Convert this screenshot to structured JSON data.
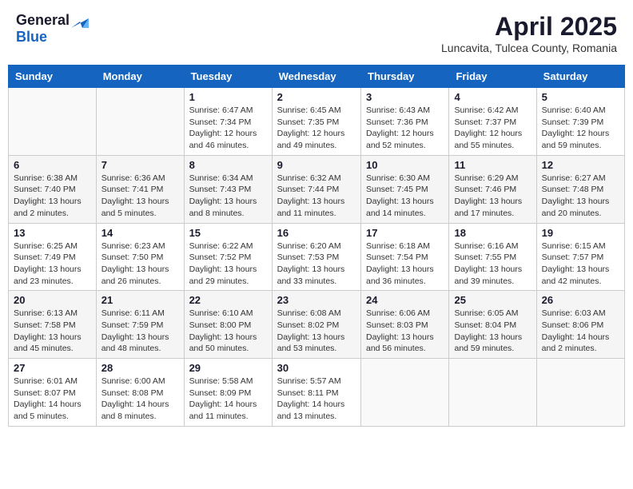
{
  "header": {
    "logo_general": "General",
    "logo_blue": "Blue",
    "month_title": "April 2025",
    "location": "Luncavita, Tulcea County, Romania"
  },
  "days_of_week": [
    "Sunday",
    "Monday",
    "Tuesday",
    "Wednesday",
    "Thursday",
    "Friday",
    "Saturday"
  ],
  "weeks": [
    [
      {
        "day": "",
        "detail": ""
      },
      {
        "day": "",
        "detail": ""
      },
      {
        "day": "1",
        "detail": "Sunrise: 6:47 AM\nSunset: 7:34 PM\nDaylight: 12 hours and 46 minutes."
      },
      {
        "day": "2",
        "detail": "Sunrise: 6:45 AM\nSunset: 7:35 PM\nDaylight: 12 hours and 49 minutes."
      },
      {
        "day": "3",
        "detail": "Sunrise: 6:43 AM\nSunset: 7:36 PM\nDaylight: 12 hours and 52 minutes."
      },
      {
        "day": "4",
        "detail": "Sunrise: 6:42 AM\nSunset: 7:37 PM\nDaylight: 12 hours and 55 minutes."
      },
      {
        "day": "5",
        "detail": "Sunrise: 6:40 AM\nSunset: 7:39 PM\nDaylight: 12 hours and 59 minutes."
      }
    ],
    [
      {
        "day": "6",
        "detail": "Sunrise: 6:38 AM\nSunset: 7:40 PM\nDaylight: 13 hours and 2 minutes."
      },
      {
        "day": "7",
        "detail": "Sunrise: 6:36 AM\nSunset: 7:41 PM\nDaylight: 13 hours and 5 minutes."
      },
      {
        "day": "8",
        "detail": "Sunrise: 6:34 AM\nSunset: 7:43 PM\nDaylight: 13 hours and 8 minutes."
      },
      {
        "day": "9",
        "detail": "Sunrise: 6:32 AM\nSunset: 7:44 PM\nDaylight: 13 hours and 11 minutes."
      },
      {
        "day": "10",
        "detail": "Sunrise: 6:30 AM\nSunset: 7:45 PM\nDaylight: 13 hours and 14 minutes."
      },
      {
        "day": "11",
        "detail": "Sunrise: 6:29 AM\nSunset: 7:46 PM\nDaylight: 13 hours and 17 minutes."
      },
      {
        "day": "12",
        "detail": "Sunrise: 6:27 AM\nSunset: 7:48 PM\nDaylight: 13 hours and 20 minutes."
      }
    ],
    [
      {
        "day": "13",
        "detail": "Sunrise: 6:25 AM\nSunset: 7:49 PM\nDaylight: 13 hours and 23 minutes."
      },
      {
        "day": "14",
        "detail": "Sunrise: 6:23 AM\nSunset: 7:50 PM\nDaylight: 13 hours and 26 minutes."
      },
      {
        "day": "15",
        "detail": "Sunrise: 6:22 AM\nSunset: 7:52 PM\nDaylight: 13 hours and 29 minutes."
      },
      {
        "day": "16",
        "detail": "Sunrise: 6:20 AM\nSunset: 7:53 PM\nDaylight: 13 hours and 33 minutes."
      },
      {
        "day": "17",
        "detail": "Sunrise: 6:18 AM\nSunset: 7:54 PM\nDaylight: 13 hours and 36 minutes."
      },
      {
        "day": "18",
        "detail": "Sunrise: 6:16 AM\nSunset: 7:55 PM\nDaylight: 13 hours and 39 minutes."
      },
      {
        "day": "19",
        "detail": "Sunrise: 6:15 AM\nSunset: 7:57 PM\nDaylight: 13 hours and 42 minutes."
      }
    ],
    [
      {
        "day": "20",
        "detail": "Sunrise: 6:13 AM\nSunset: 7:58 PM\nDaylight: 13 hours and 45 minutes."
      },
      {
        "day": "21",
        "detail": "Sunrise: 6:11 AM\nSunset: 7:59 PM\nDaylight: 13 hours and 48 minutes."
      },
      {
        "day": "22",
        "detail": "Sunrise: 6:10 AM\nSunset: 8:00 PM\nDaylight: 13 hours and 50 minutes."
      },
      {
        "day": "23",
        "detail": "Sunrise: 6:08 AM\nSunset: 8:02 PM\nDaylight: 13 hours and 53 minutes."
      },
      {
        "day": "24",
        "detail": "Sunrise: 6:06 AM\nSunset: 8:03 PM\nDaylight: 13 hours and 56 minutes."
      },
      {
        "day": "25",
        "detail": "Sunrise: 6:05 AM\nSunset: 8:04 PM\nDaylight: 13 hours and 59 minutes."
      },
      {
        "day": "26",
        "detail": "Sunrise: 6:03 AM\nSunset: 8:06 PM\nDaylight: 14 hours and 2 minutes."
      }
    ],
    [
      {
        "day": "27",
        "detail": "Sunrise: 6:01 AM\nSunset: 8:07 PM\nDaylight: 14 hours and 5 minutes."
      },
      {
        "day": "28",
        "detail": "Sunrise: 6:00 AM\nSunset: 8:08 PM\nDaylight: 14 hours and 8 minutes."
      },
      {
        "day": "29",
        "detail": "Sunrise: 5:58 AM\nSunset: 8:09 PM\nDaylight: 14 hours and 11 minutes."
      },
      {
        "day": "30",
        "detail": "Sunrise: 5:57 AM\nSunset: 8:11 PM\nDaylight: 14 hours and 13 minutes."
      },
      {
        "day": "",
        "detail": ""
      },
      {
        "day": "",
        "detail": ""
      },
      {
        "day": "",
        "detail": ""
      }
    ]
  ]
}
